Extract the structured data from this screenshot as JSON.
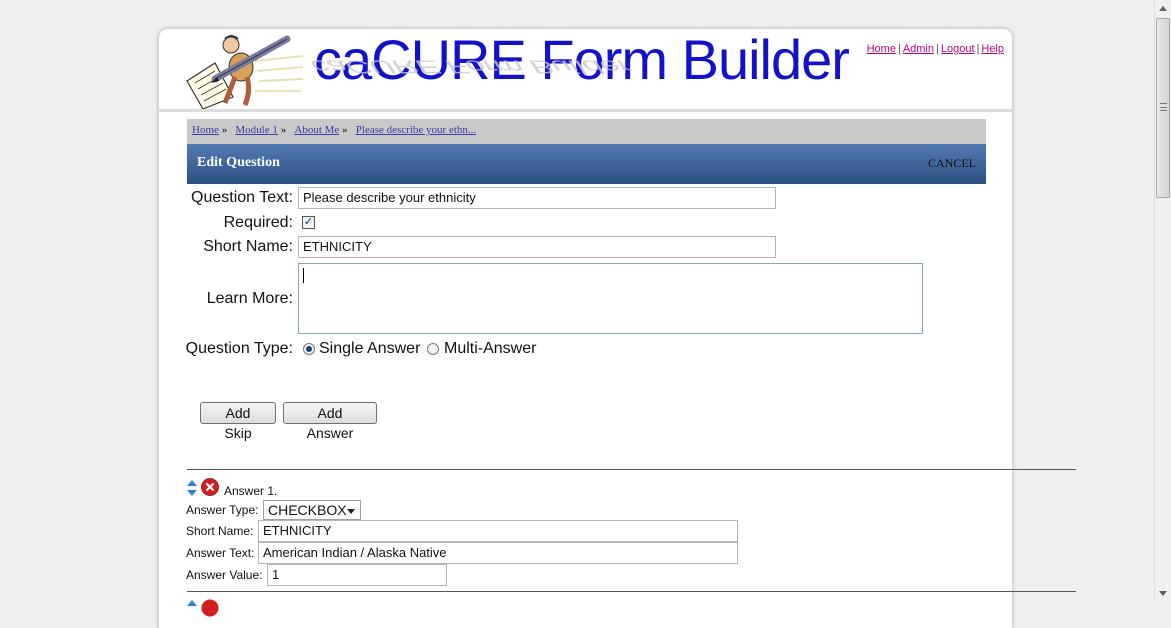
{
  "app": {
    "title": "caCURE Form Builder",
    "top_links": [
      "Home",
      "Admin",
      "Logout",
      "Help"
    ]
  },
  "breadcrumb": [
    "Home",
    "Module 1",
    "About Me",
    "Please describe your ethn..."
  ],
  "edit_bar": {
    "title": "Edit Question",
    "cancel": "CANCEL"
  },
  "form": {
    "question_text_label": "Question Text:",
    "question_text_value": "Please describe your ethnicity",
    "required_label": "Required:",
    "required_checked": true,
    "short_name_label": "Short Name:",
    "short_name_value": "ETHNICITY",
    "learn_more_label": "Learn More:",
    "learn_more_value": "",
    "question_type_label": "Question Type:",
    "question_type_options": [
      "Single Answer",
      "Multi-Answer"
    ],
    "question_type_selected": "Single Answer"
  },
  "buttons": {
    "add_skip": "Add Skip",
    "add_answer": "Add Answer"
  },
  "answer": {
    "heading": "Answer 1.",
    "type_label": "Answer Type:",
    "type_value": "CHECKBOX",
    "short_name_label": "Short Name:",
    "short_name_value": "ETHNICITY",
    "text_label": "Answer Text:",
    "text_value": "American Indian / Alaska Native",
    "value_label": "Answer Value:",
    "value_value": "1"
  },
  "colors": {
    "title_blue": "#1212cc",
    "link_magenta": "#c00080",
    "bar_blue_top": "#547ab4",
    "bar_blue_bottom": "#2b5182",
    "breadcrumb_bg": "#c9c9c9"
  }
}
